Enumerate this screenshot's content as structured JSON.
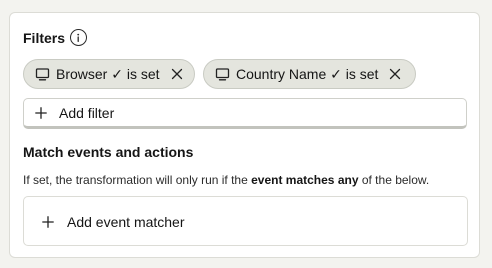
{
  "filters": {
    "title": "Filters",
    "info_icon": "info-icon",
    "chips": [
      {
        "icon": "monitor-icon",
        "label": "Browser ✓ is set",
        "remove_icon": "close-icon"
      },
      {
        "icon": "monitor-icon",
        "label": "Country Name ✓ is set",
        "remove_icon": "close-icon"
      }
    ],
    "add_filter_label": "Add filter",
    "add_icon": "plus-icon"
  },
  "match": {
    "title": "Match events and actions",
    "help_prefix": "If set, the transformation will only run if the",
    "help_bold": "event matches any",
    "help_suffix": "of the below.",
    "add_matcher_label": "Add event matcher",
    "add_icon": "plus-icon"
  }
}
